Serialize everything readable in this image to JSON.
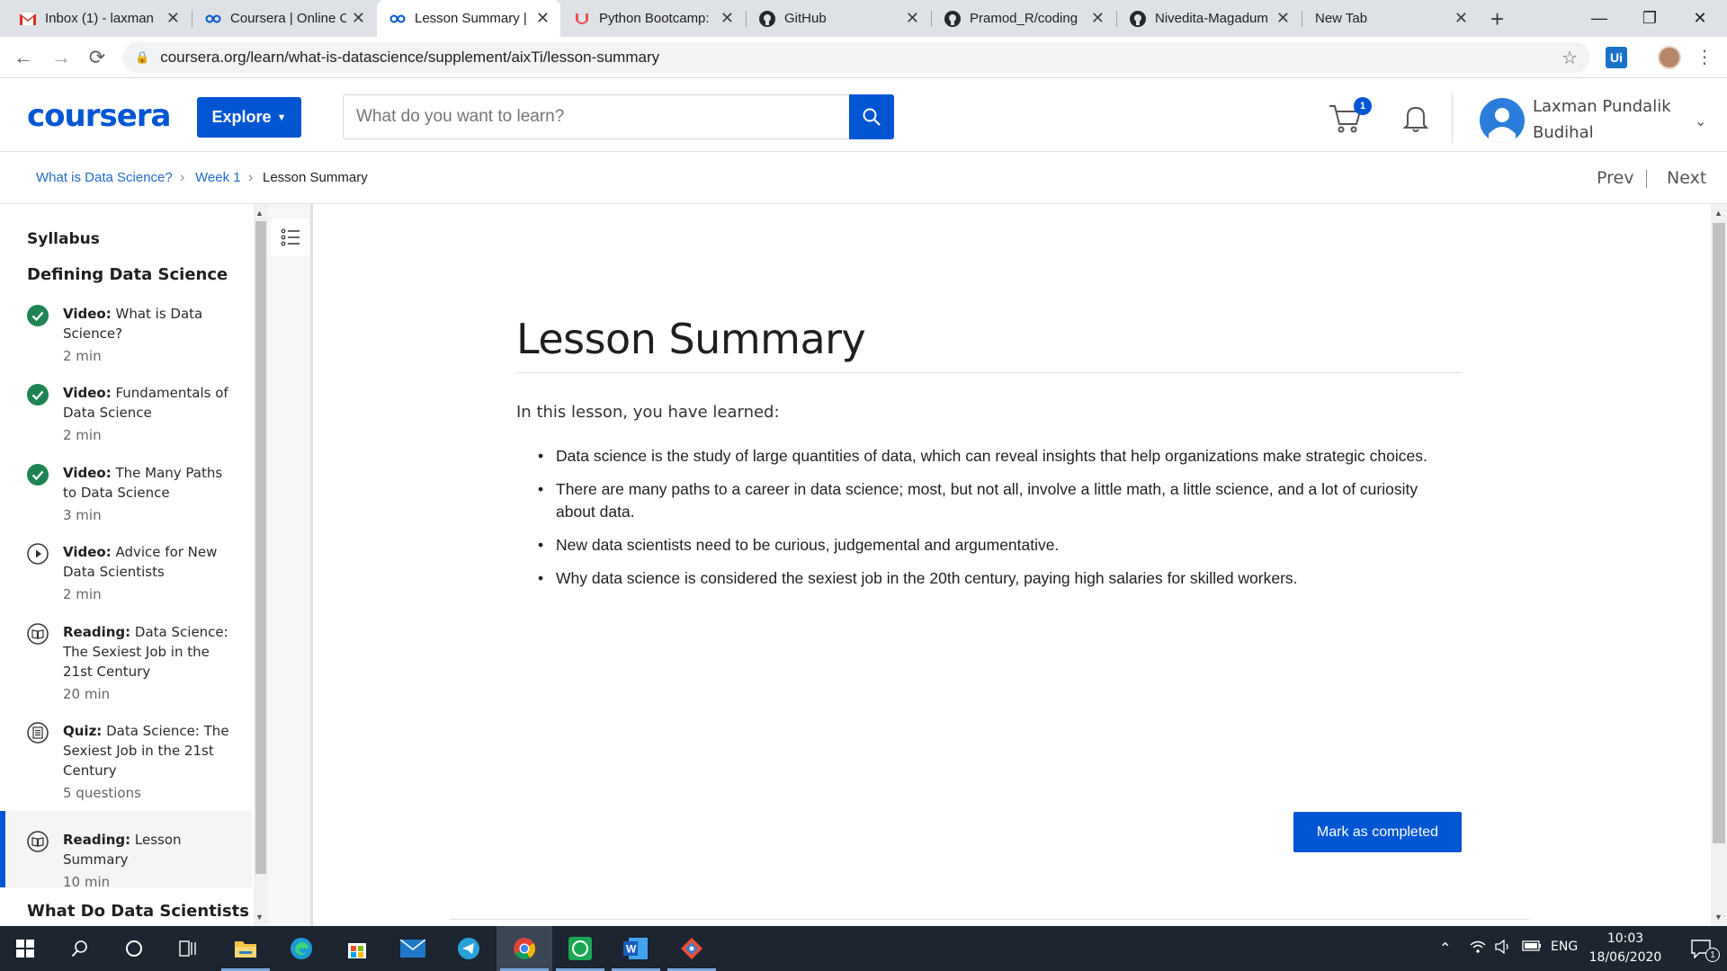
{
  "browser": {
    "tabs": [
      {
        "title": "Inbox (1) - laxman",
        "icon": "gmail-icon"
      },
      {
        "title": "Coursera | Online C",
        "icon": "coursera-icon"
      },
      {
        "title": "Lesson Summary |",
        "icon": "coursera-icon"
      },
      {
        "title": "Python Bootcamp:",
        "icon": "udemy-icon"
      },
      {
        "title": "GitHub",
        "icon": "github-icon"
      },
      {
        "title": "Pramod_R/coding",
        "icon": "github-icon"
      },
      {
        "title": "Nivedita-Magadum",
        "icon": "github-icon"
      },
      {
        "title": "New Tab",
        "icon": ""
      }
    ],
    "url": "coursera.org/learn/what-is-datascience/supplement/aixTi/lesson-summary",
    "extension_label": "Ui"
  },
  "header": {
    "logo": "coursera",
    "explore_label": "Explore",
    "search_placeholder": "What do you want to learn?",
    "cart_count": "1",
    "user_name": "Laxman Pundalik Budihal"
  },
  "breadcrumb": {
    "items": [
      "What is Data Science?",
      "Week 1",
      "Lesson Summary"
    ],
    "prev_label": "Prev",
    "next_label": "Next"
  },
  "sidebar": {
    "syllabus_label": "Syllabus",
    "section_title": "Defining Data Science",
    "items": [
      {
        "type": "Video:",
        "title": "What is Data Science?",
        "duration": "2 min",
        "status": "completed"
      },
      {
        "type": "Video:",
        "title": "Fundamentals of Data Science",
        "duration": "2 min",
        "status": "completed"
      },
      {
        "type": "Video:",
        "title": "The Many Paths to Data Science",
        "duration": "3 min",
        "status": "completed"
      },
      {
        "type": "Video:",
        "title": "Advice for New Data Scientists",
        "duration": "2 min",
        "status": "play"
      },
      {
        "type": "Reading:",
        "title": "Data Science: The Sexiest Job in the 21st Century",
        "duration": "20 min",
        "status": "reading"
      },
      {
        "type": "Quiz:",
        "title": "Data Science: The Sexiest Job in the 21st Century",
        "duration": "5 questions",
        "status": "quiz"
      },
      {
        "type": "Reading:",
        "title": "Lesson Summary",
        "duration": "10 min",
        "status": "reading"
      }
    ],
    "next_section": "What Do Data Scientists Do?"
  },
  "content": {
    "title": "Lesson Summary",
    "intro": "In this lesson, you have learned:",
    "bullets": [
      "Data science is the study of large quantities of data, which can reveal insights that help organizations make strategic choices.",
      "There are  many paths to a career in data science; most, but not all, involve a little math, a little science, and a lot of curiosity about data.",
      "New data scientists need to be curious, judgemental and argumentative.",
      "Why data science is considered the sexiest job in the 20th century, paying high salaries for skilled workers."
    ],
    "mark_completed_label": "Mark as completed"
  },
  "taskbar": {
    "language": "ENG",
    "time": "10:03",
    "date": "18/06/2020",
    "notification_count": "1"
  },
  "colors": {
    "brand_blue": "#0056d2",
    "completed_green": "#1f8354"
  }
}
